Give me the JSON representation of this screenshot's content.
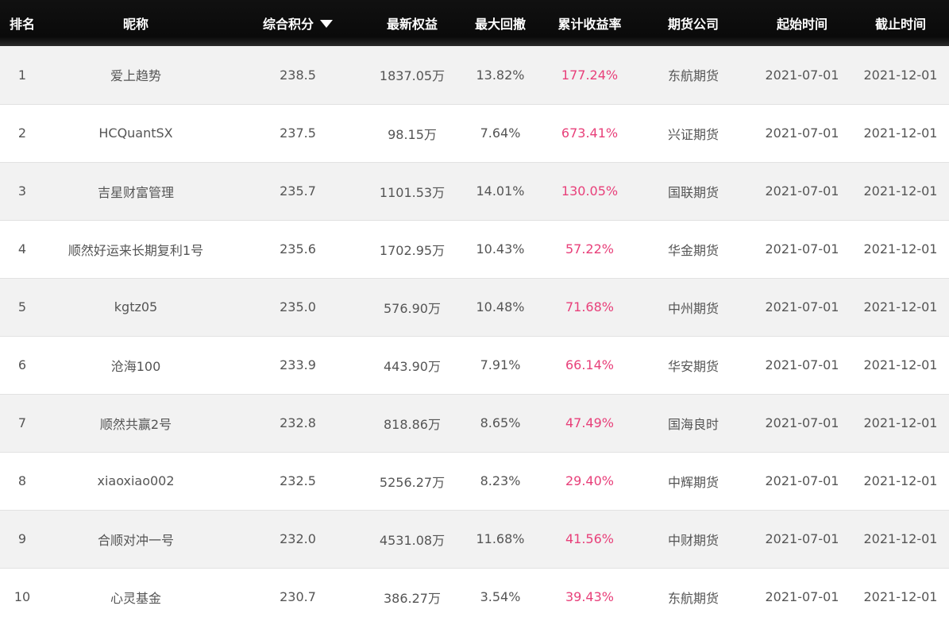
{
  "columns": {
    "rank": "排名",
    "nickname": "昵称",
    "score": "综合积分",
    "equity": "最新权益",
    "drawdown": "最大回撤",
    "return": "累计收益率",
    "company": "期货公司",
    "start": "起始时间",
    "end": "截止时间"
  },
  "sort_icon": "sort-desc-icon",
  "colors": {
    "header_bg": "#111111",
    "return_text": "#e8407a",
    "row_alt_bg": "#f2f2f2"
  },
  "rows": [
    {
      "rank": "1",
      "nickname": "爱上趋势",
      "score": "238.5",
      "equity": "1837.05万",
      "drawdown": "13.82%",
      "return": "177.24%",
      "company": "东航期货",
      "start": "2021-07-01",
      "end": "2021-12-01"
    },
    {
      "rank": "2",
      "nickname": "HCQuantSX",
      "score": "237.5",
      "equity": "98.15万",
      "drawdown": "7.64%",
      "return": "673.41%",
      "company": "兴证期货",
      "start": "2021-07-01",
      "end": "2021-12-01"
    },
    {
      "rank": "3",
      "nickname": "吉星财富管理",
      "score": "235.7",
      "equity": "1101.53万",
      "drawdown": "14.01%",
      "return": "130.05%",
      "company": "国联期货",
      "start": "2021-07-01",
      "end": "2021-12-01"
    },
    {
      "rank": "4",
      "nickname": "顺然好运来长期复利1号",
      "score": "235.6",
      "equity": "1702.95万",
      "drawdown": "10.43%",
      "return": "57.22%",
      "company": "华金期货",
      "start": "2021-07-01",
      "end": "2021-12-01"
    },
    {
      "rank": "5",
      "nickname": "kgtz05",
      "score": "235.0",
      "equity": "576.90万",
      "drawdown": "10.48%",
      "return": "71.68%",
      "company": "中州期货",
      "start": "2021-07-01",
      "end": "2021-12-01"
    },
    {
      "rank": "6",
      "nickname": "沧海100",
      "score": "233.9",
      "equity": "443.90万",
      "drawdown": "7.91%",
      "return": "66.14%",
      "company": "华安期货",
      "start": "2021-07-01",
      "end": "2021-12-01"
    },
    {
      "rank": "7",
      "nickname": "顺然共赢2号",
      "score": "232.8",
      "equity": "818.86万",
      "drawdown": "8.65%",
      "return": "47.49%",
      "company": "国海良时",
      "start": "2021-07-01",
      "end": "2021-12-01"
    },
    {
      "rank": "8",
      "nickname": "xiaoxiao002",
      "score": "232.5",
      "equity": "5256.27万",
      "drawdown": "8.23%",
      "return": "29.40%",
      "company": "中辉期货",
      "start": "2021-07-01",
      "end": "2021-12-01"
    },
    {
      "rank": "9",
      "nickname": "合顺对冲一号",
      "score": "232.0",
      "equity": "4531.08万",
      "drawdown": "11.68%",
      "return": "41.56%",
      "company": "中财期货",
      "start": "2021-07-01",
      "end": "2021-12-01"
    },
    {
      "rank": "10",
      "nickname": "心灵基金",
      "score": "230.7",
      "equity": "386.27万",
      "drawdown": "3.54%",
      "return": "39.43%",
      "company": "东航期货",
      "start": "2021-07-01",
      "end": "2021-12-01"
    }
  ]
}
